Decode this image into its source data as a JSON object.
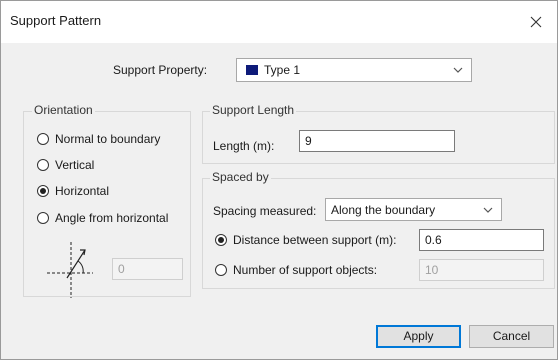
{
  "window": {
    "title": "Support Pattern"
  },
  "support_property": {
    "label": "Support Property:",
    "value": "Type 1",
    "swatch_color": "#0e1b7a"
  },
  "orientation": {
    "title": "Orientation",
    "options": [
      {
        "label": "Normal to boundary",
        "checked": false
      },
      {
        "label": "Vertical",
        "checked": false
      },
      {
        "label": "Horizontal",
        "checked": true
      },
      {
        "label": "Angle from horizontal",
        "checked": false
      }
    ],
    "angle_value": "0"
  },
  "support_length": {
    "title": "Support Length",
    "label": "Length (m):",
    "value": "9"
  },
  "spaced_by": {
    "title": "Spaced by",
    "spacing_label": "Spacing measured:",
    "spacing_value": "Along the boundary",
    "distance_label": "Distance between support (m):",
    "distance_value": "0.6",
    "distance_checked": true,
    "number_label": "Number of support objects:",
    "number_value": "10",
    "number_checked": false
  },
  "buttons": {
    "apply": "Apply",
    "cancel": "Cancel"
  }
}
